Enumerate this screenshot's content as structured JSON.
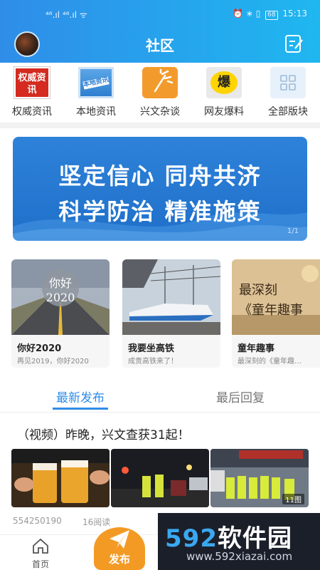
{
  "status_bar": {
    "left": "⁴⁶.ıl ⁴⁶.ıl ᯤ",
    "right_icons": "⏰ ∗ ▯",
    "battery": "68",
    "time": "15:13"
  },
  "header": {
    "title": "社区"
  },
  "categories": [
    {
      "label": "权威资讯",
      "icon_text": "权威资讯",
      "icon": "quanwei-logo"
    },
    {
      "label": "本地资讯",
      "icon_text": "本地资讯",
      "icon": "bendi-logo"
    },
    {
      "label": "兴文杂谈",
      "icon": "sparkle-icon"
    },
    {
      "label": "网友爆料",
      "icon_text": "爆",
      "icon": "bao-logo"
    },
    {
      "label": "全部版块",
      "icon": "grid-icon"
    }
  ],
  "banner": {
    "line1": "坚定信心  同舟共济",
    "line2": "科学防治  精准施策",
    "pager": "1/1"
  },
  "cards": [
    {
      "title": "你好2020",
      "subtitle": "再见2019，你好2020",
      "overlay_line1": "你好",
      "overlay_line2": "2020"
    },
    {
      "title": "我要坐高铁",
      "subtitle": "成贵高铁来了！"
    },
    {
      "title": "童年趣事",
      "subtitle": "最深刻的《童年趣…",
      "overlay_line1": "最深刻",
      "overlay_line2": "《童年趣事"
    }
  ],
  "tabs": [
    {
      "label": "最新发布"
    },
    {
      "label": "最后回复"
    }
  ],
  "post": {
    "title": "（视频）昨晚，兴文查获31起！",
    "image_count": "11图",
    "author": "554250190",
    "reads": "16阅读"
  },
  "bottom_nav": {
    "home": "首页",
    "publish": "发布"
  },
  "watermark": {
    "brand_num": "592",
    "brand_text": "软件园",
    "url": "www.592xiazai.com"
  },
  "colors": {
    "primary": "#2f8de8",
    "accent": "#f39a25"
  }
}
